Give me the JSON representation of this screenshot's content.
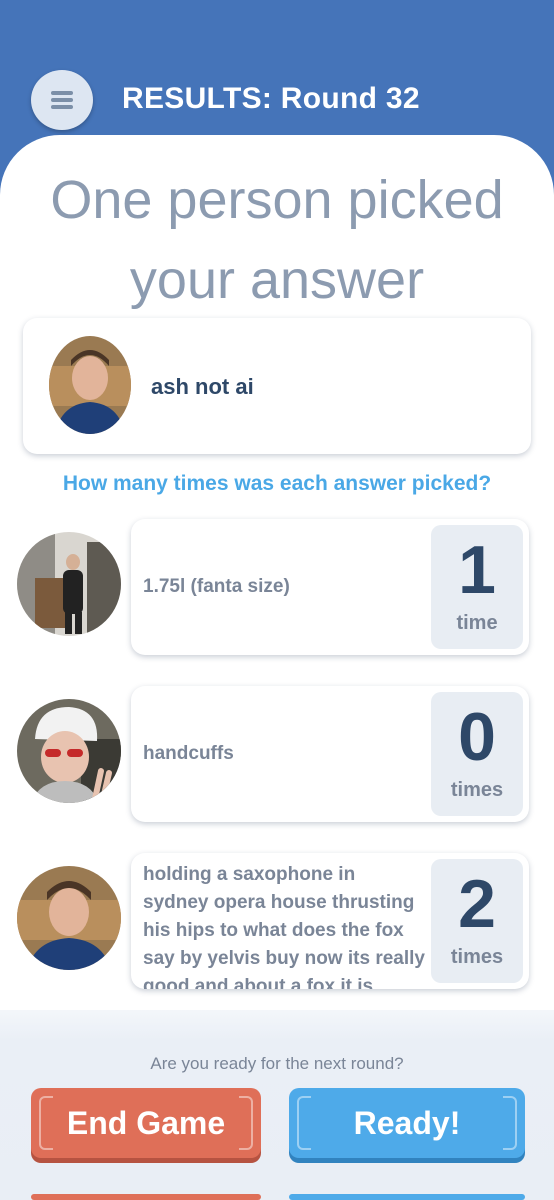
{
  "header": {
    "title": "RESULTS: Round 32",
    "menu_icon": "menu-icon"
  },
  "headline": "One person picked your answer",
  "picker": {
    "name": "ash not ai"
  },
  "question": "How many times was each answer picked?",
  "answers": [
    {
      "text": "1.75l (fanta size)",
      "count": "1",
      "unit": "time"
    },
    {
      "text": "handcuffs",
      "count": "0",
      "unit": "times"
    },
    {
      "text": "holding a saxophone in sydney opera house thrusting his hips to what does the fox say by yelvis buy now its really good and about a fox it is",
      "count": "2",
      "unit": "times"
    }
  ],
  "footer": {
    "prompt": "Are you ready for the next round?",
    "end_label": "End Game",
    "ready_label": "Ready!"
  },
  "colors": {
    "header_blue": "#4574b9",
    "end_red": "#df6f58",
    "ready_blue": "#4eaae9",
    "accent_text": "#4aa8e6"
  }
}
